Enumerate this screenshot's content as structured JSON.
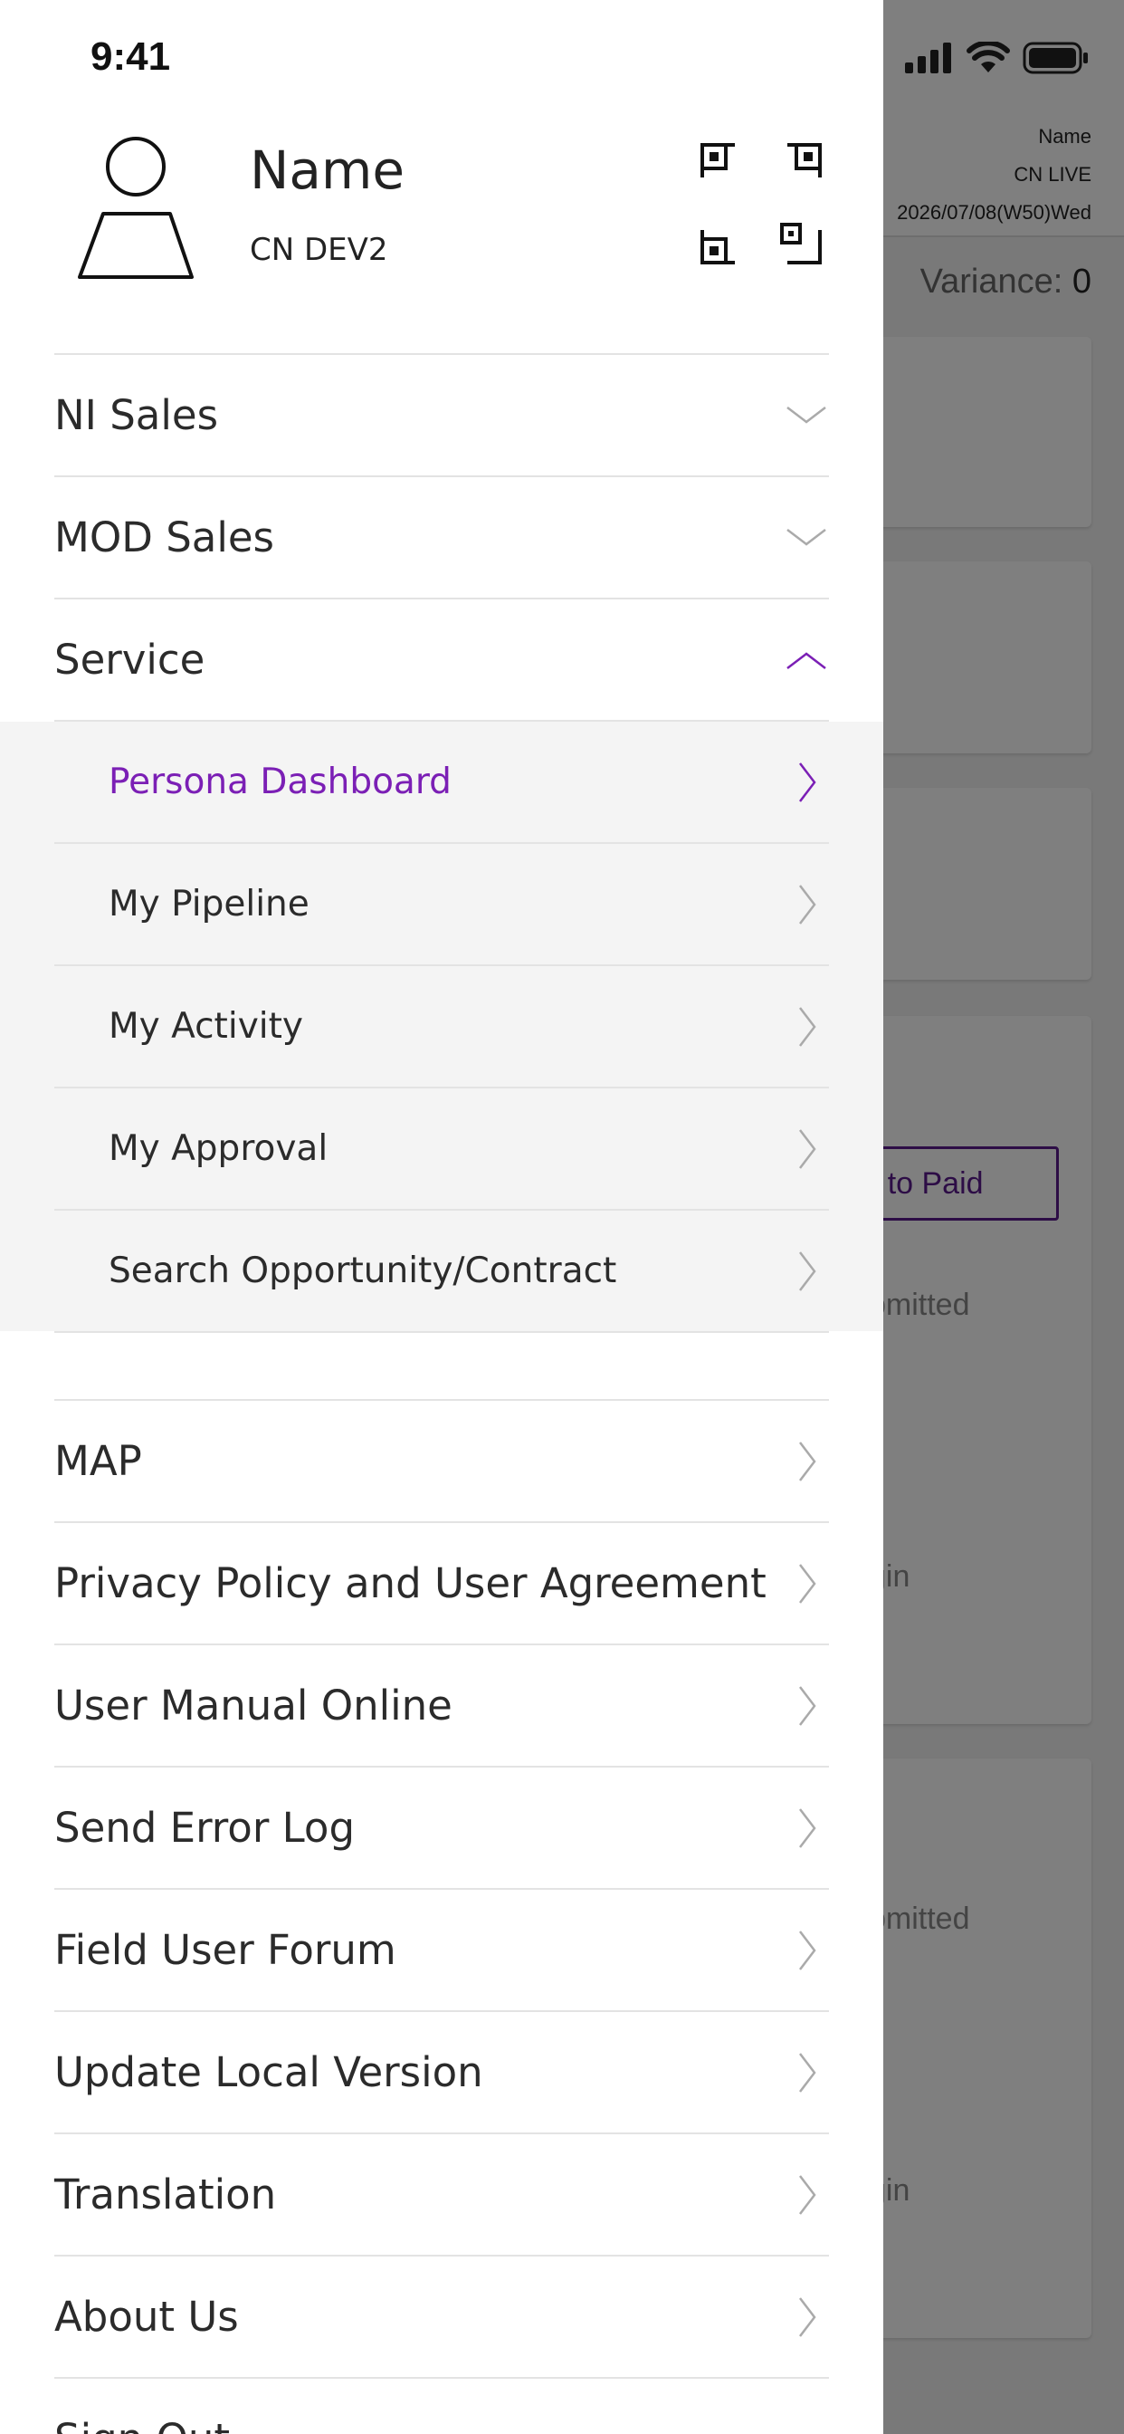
{
  "status_bar": {
    "time": "9:41"
  },
  "background_page": {
    "name": "Name",
    "environment": "CN LIVE",
    "date": "2026/07/08(W50)Wed",
    "variance_label": "Variance:",
    "variance_value": "0",
    "button_label": "ee to Paid",
    "texts": [
      "bmitted",
      "gin",
      "bmitted",
      "gin"
    ]
  },
  "profile": {
    "name": "Name",
    "environment": "CN DEV2"
  },
  "menu": {
    "sections": [
      {
        "label": "NI Sales",
        "expanded": false
      },
      {
        "label": "MOD Sales",
        "expanded": false
      },
      {
        "label": "Service",
        "expanded": true
      }
    ],
    "service_items": [
      {
        "label": "Persona Dashboard",
        "active": true
      },
      {
        "label": "My Pipeline",
        "active": false
      },
      {
        "label": "My Activity",
        "active": false
      },
      {
        "label": "My Approval",
        "active": false
      },
      {
        "label": "Search Opportunity/Contract",
        "active": false
      }
    ],
    "links": [
      "MAP",
      "Privacy Policy and User Agreement",
      "User Manual Online",
      "Send Error Log",
      "Field User Forum",
      "Update Local Version",
      "Translation",
      "About Us",
      "Sign Out"
    ]
  },
  "colors": {
    "accent": "#7b1fb5",
    "overlay": "rgba(0,0,0,0.5)",
    "submenu_bg": "#f4f4f4"
  }
}
